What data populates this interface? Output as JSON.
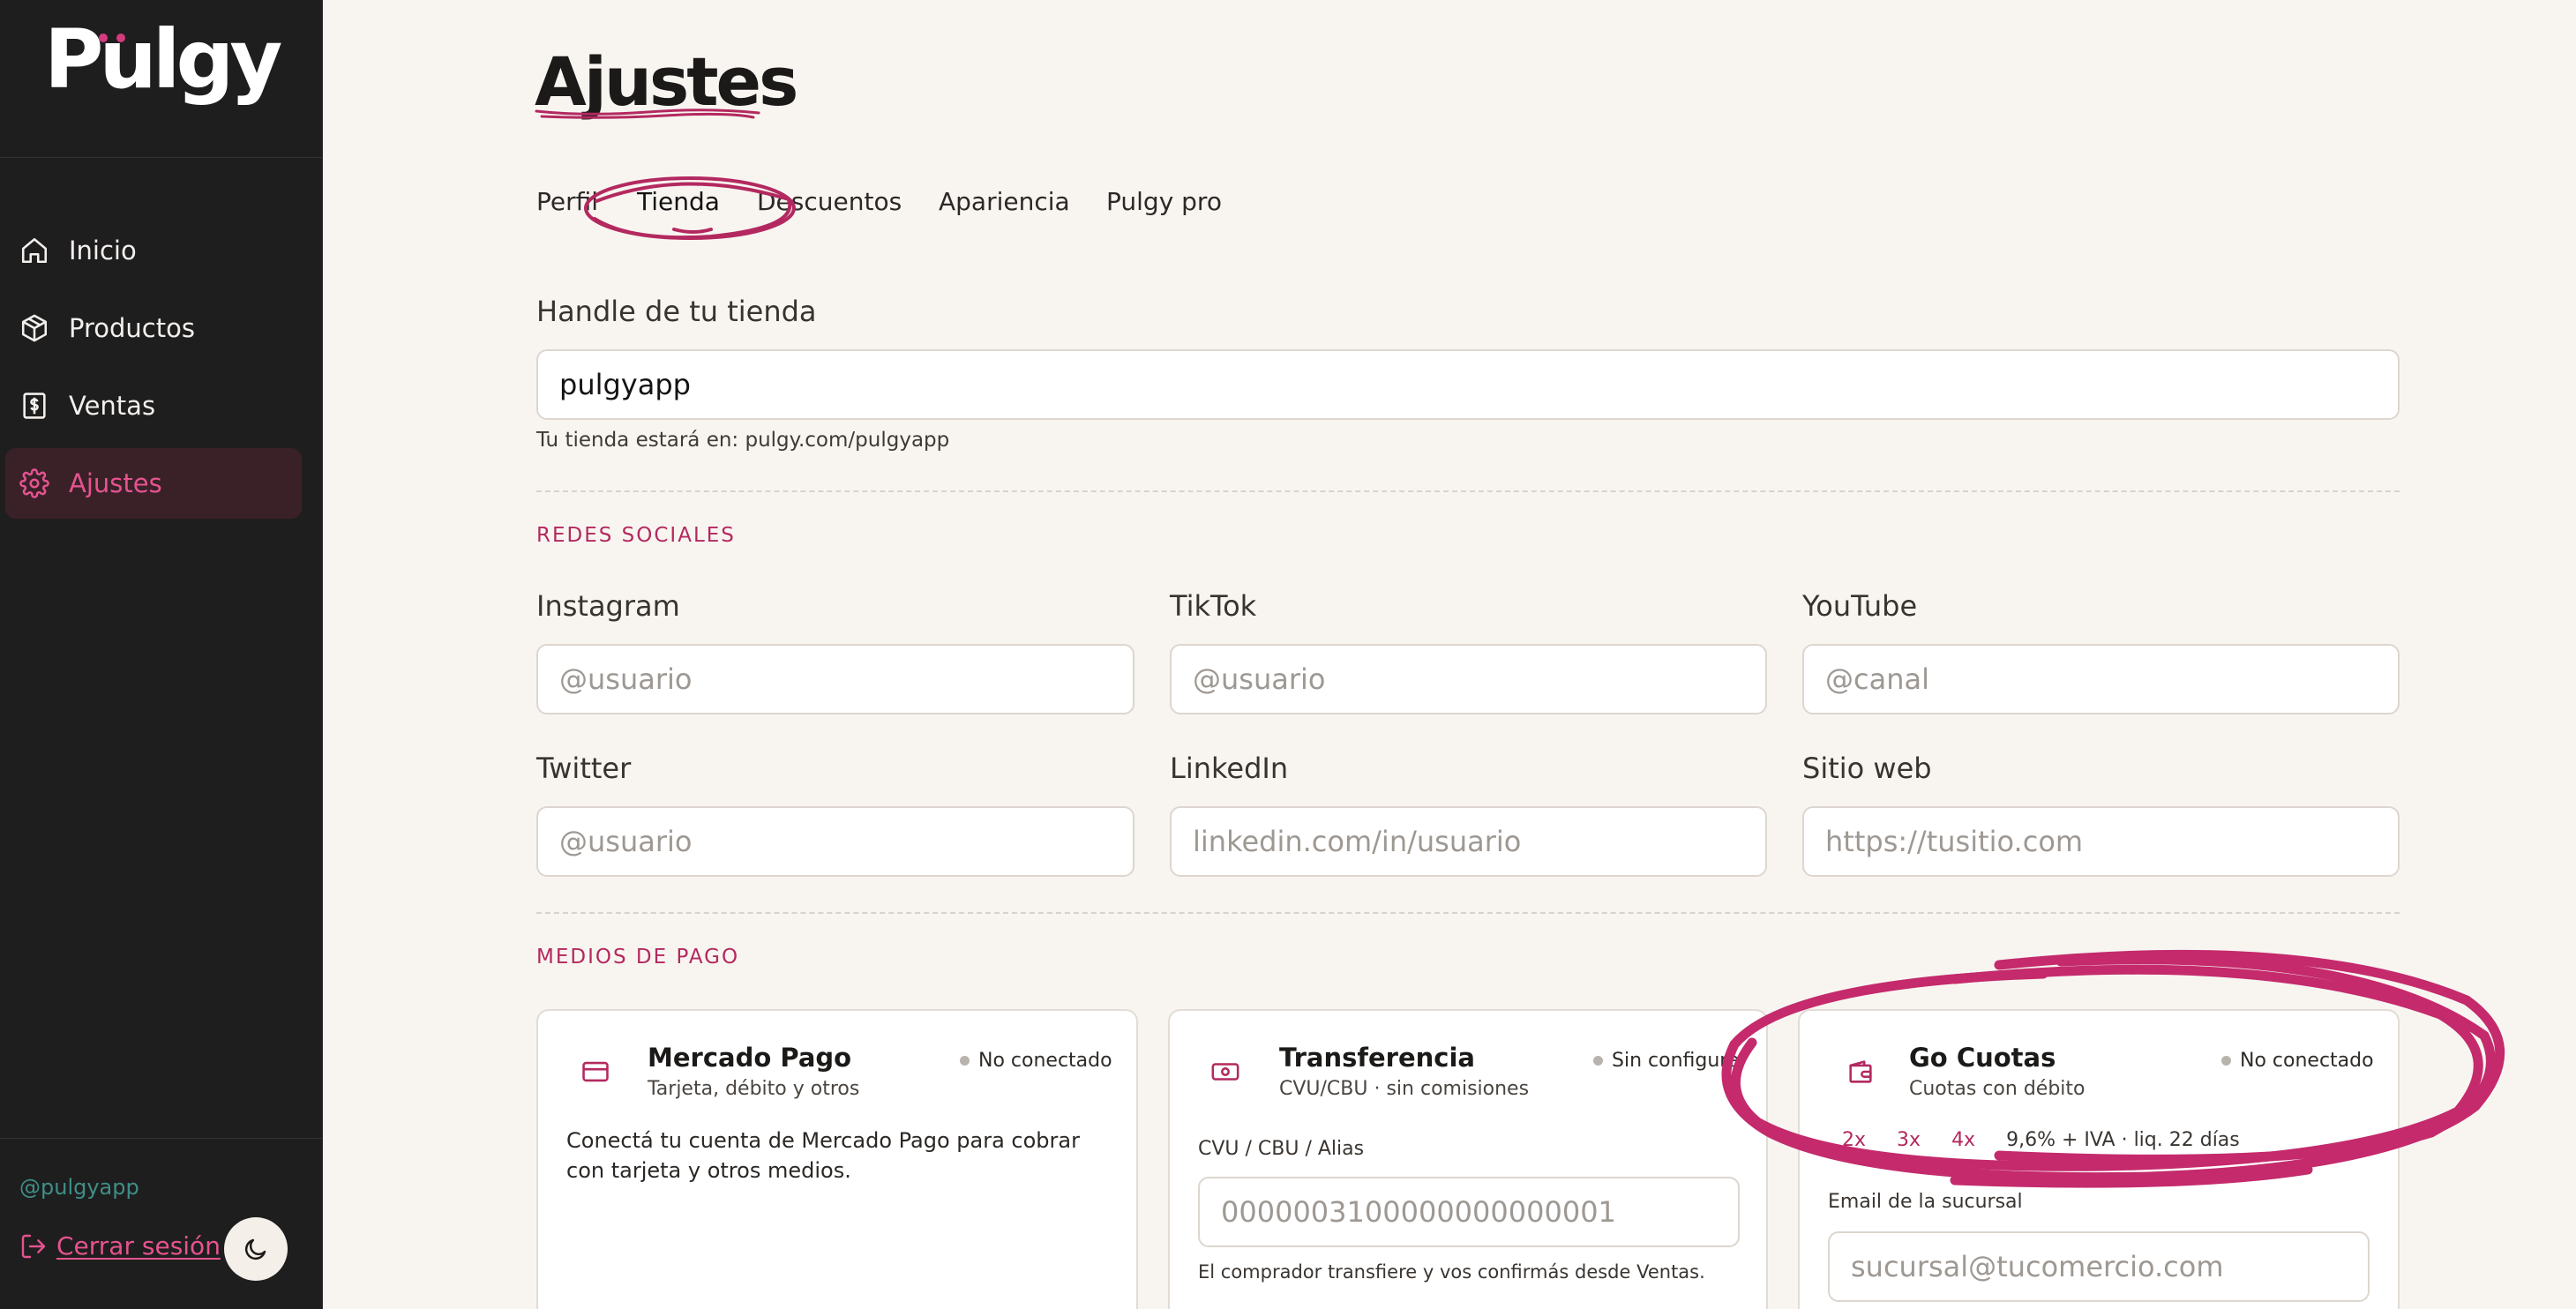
{
  "brand": {
    "name": "Pulgy",
    "accent": "#b3295f",
    "accent_bright": "#e5538f",
    "sidebar_bg": "#1f1e1e",
    "page_bg": "#f8f5f1"
  },
  "sidebar": {
    "items": [
      {
        "label": "Inicio",
        "icon": "home-icon",
        "active": false
      },
      {
        "label": "Productos",
        "icon": "box-icon",
        "active": false
      },
      {
        "label": "Ventas",
        "icon": "dollar-receipt-icon",
        "active": false
      },
      {
        "label": "Ajustes",
        "icon": "gear-icon",
        "active": true
      }
    ],
    "handle": "@pulgyapp",
    "logout_label": "Cerrar sesión",
    "theme_icon": "moon-icon"
  },
  "main": {
    "title": "Ajustes",
    "tabs": [
      {
        "label": "Perfil",
        "active": false
      },
      {
        "label": "Tienda",
        "active": true
      },
      {
        "label": "Descuentos",
        "active": false
      },
      {
        "label": "Apariencia",
        "active": false
      },
      {
        "label": "Pulgy pro",
        "active": false
      }
    ],
    "store_handle": {
      "label": "Handle de tu tienda",
      "value": "pulgyapp",
      "helper": "Tu tienda estará en: pulgy.com/pulgyapp"
    },
    "social": {
      "section_title": "REDES SOCIALES",
      "fields": [
        {
          "label": "Instagram",
          "placeholder": "@usuario"
        },
        {
          "label": "TikTok",
          "placeholder": "@usuario"
        },
        {
          "label": "YouTube",
          "placeholder": "@canal"
        },
        {
          "label": "Twitter",
          "placeholder": "@usuario"
        },
        {
          "label": "LinkedIn",
          "placeholder": "linkedin.com/in/usuario"
        },
        {
          "label": "Sitio web",
          "placeholder": "https://tusitio.com"
        }
      ]
    },
    "payments": {
      "section_title": "MEDIOS DE PAGO",
      "mercado_pago": {
        "title": "Mercado Pago",
        "subtitle": "Tarjeta, débito y otros",
        "status": "No conectado",
        "description": "Conectá tu cuenta de Mercado Pago para cobrar con tarjeta y otros medios.",
        "icon": "card-icon"
      },
      "transferencia": {
        "title": "Transferencia",
        "subtitle": "CVU/CBU · sin comisiones",
        "status": "Sin configurar",
        "field_label": "CVU / CBU / Alias",
        "placeholder": "0000003100000000000001",
        "helper": "El comprador transfiere y vos confirmás desde Ventas.",
        "icon": "banknote-icon"
      },
      "go_cuotas": {
        "title": "Go Cuotas",
        "subtitle": "Cuotas con débito",
        "status": "No conectado",
        "installments": [
          "2x",
          "3x",
          "4x"
        ],
        "fee": "9,6% + IVA · liq. 22 días",
        "field_label": "Email de la sucursal",
        "placeholder": "sucursal@tucomercio.com",
        "icon": "wallet-icon"
      }
    }
  }
}
